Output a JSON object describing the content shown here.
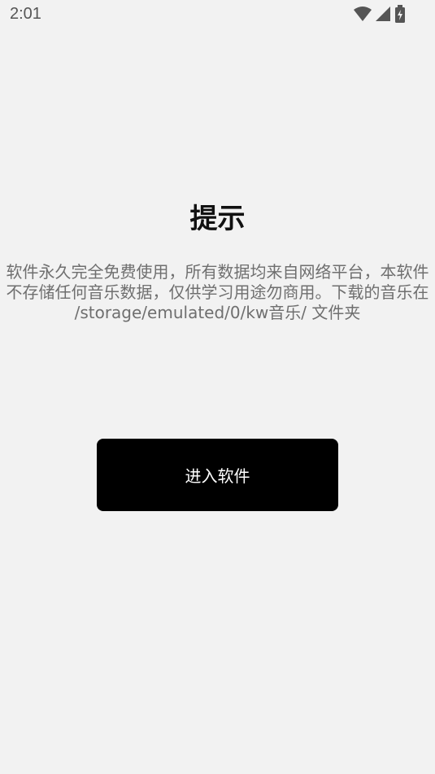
{
  "status_bar": {
    "time": "2:01",
    "icons": [
      "wifi-icon",
      "cellular-signal-icon",
      "battery-charging-icon"
    ]
  },
  "dialog": {
    "title": "提示",
    "message": "软件永久完全免费使用，所有数据均来自网络平台，本软件不存储任何音乐数据，仅供学习用途勿商用。下载的音乐在 /storage/emulated/0/kw音乐/ 文件夹",
    "enter_button_label": "进入软件"
  },
  "colors": {
    "background": "#f2f2f2",
    "button_background": "#000000",
    "button_text": "#ffffff",
    "title_text": "#111111",
    "message_text": "#6f6f6f"
  }
}
